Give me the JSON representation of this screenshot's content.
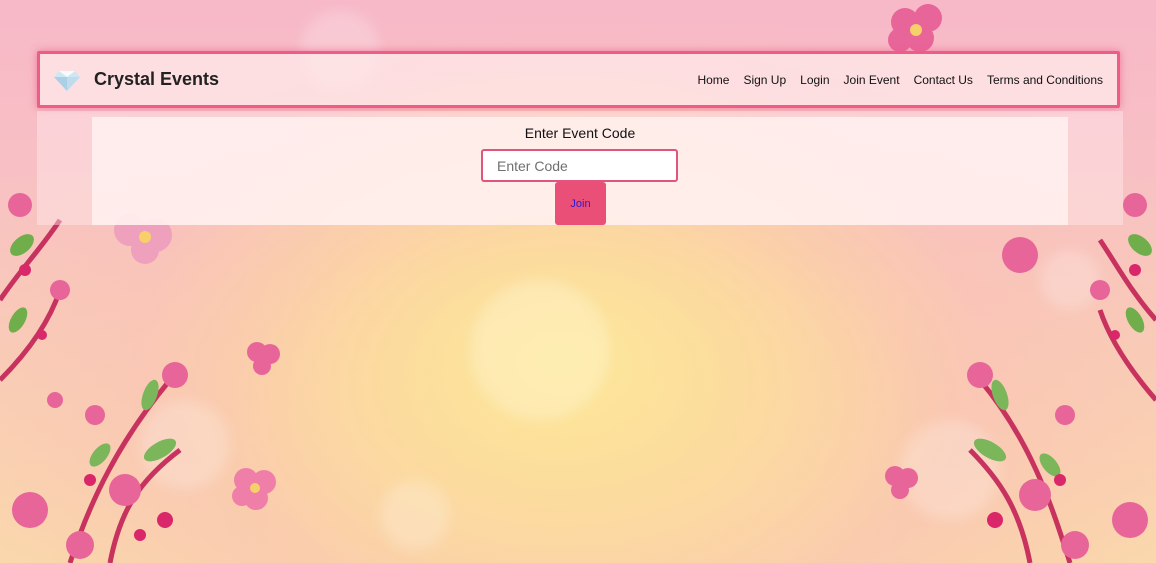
{
  "brand": {
    "name": "Crystal Events",
    "logo_icon": "diamond-icon"
  },
  "nav": {
    "items": [
      {
        "label": "Home"
      },
      {
        "label": "Sign Up"
      },
      {
        "label": "Login"
      },
      {
        "label": "Join Event"
      },
      {
        "label": "Contact Us"
      },
      {
        "label": "Terms and Conditions"
      }
    ]
  },
  "join_form": {
    "title": "Enter Event Code",
    "code_placeholder": "Enter Code",
    "code_value": "",
    "join_label": "Join"
  },
  "colors": {
    "accent": "#ec5d87",
    "button_bg": "#ea4f78",
    "button_text": "#2f1ad6"
  },
  "background_icon": "cherry-blossom-icon"
}
